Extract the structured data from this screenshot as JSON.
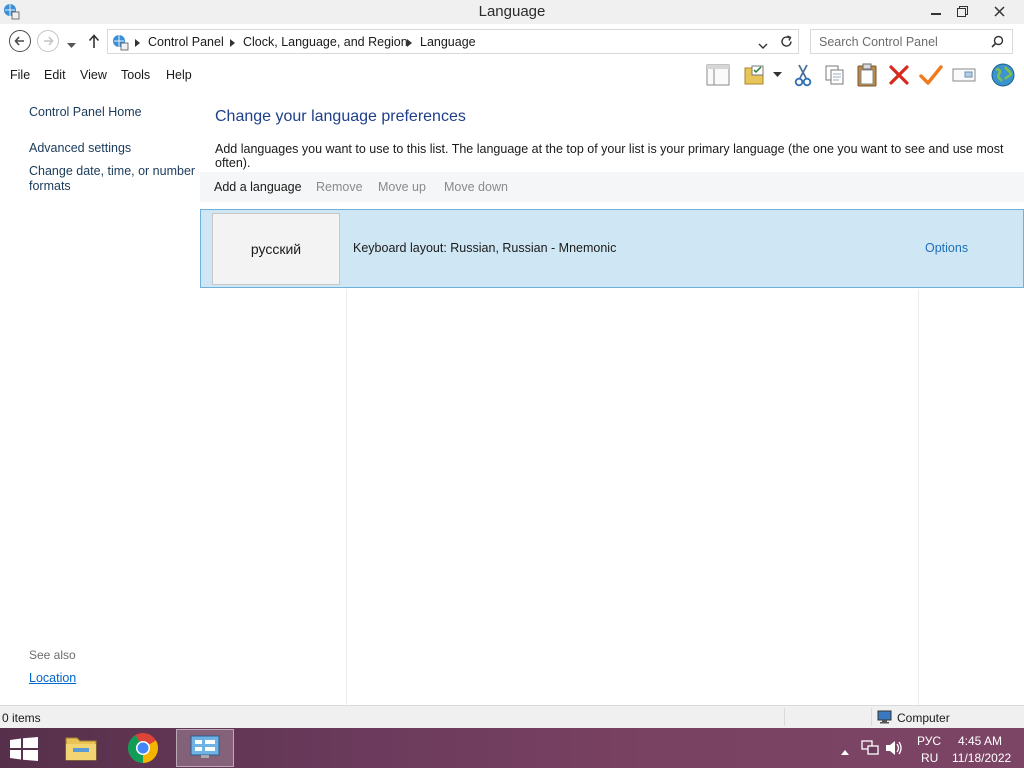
{
  "window": {
    "title": "Language",
    "controls": [
      "minimize",
      "restore",
      "close"
    ]
  },
  "address_bar": {
    "breadcrumbs": [
      "Control Panel",
      "Clock, Language, and Region",
      "Language"
    ],
    "search_placeholder": "Search Control Panel"
  },
  "menu": {
    "items": [
      "File",
      "Edit",
      "View",
      "Tools",
      "Help"
    ]
  },
  "toolbar_icons": [
    "layout-icon",
    "properties-icon",
    "cut-icon",
    "copy-icon",
    "paste-icon",
    "delete-icon",
    "checkmark-icon",
    "rename-icon",
    "globe-icon"
  ],
  "left_nav": {
    "home": "Control Panel Home",
    "links": [
      "Advanced settings",
      "Change date, time, or number formats"
    ],
    "see_also_label": "See also",
    "see_also_links": [
      "Location"
    ]
  },
  "main": {
    "heading": "Change your language preferences",
    "description": "Add languages you want to use to this list. The language at the top of your list is your primary language (the one you want to see and use most often).",
    "commands": [
      {
        "label": "Add a language",
        "enabled": true
      },
      {
        "label": "Remove",
        "enabled": false
      },
      {
        "label": "Move up",
        "enabled": false
      },
      {
        "label": "Move down",
        "enabled": false
      }
    ],
    "languages": [
      {
        "name": "русский",
        "detail": "Keyboard layout: Russian, Russian - Mnemonic",
        "options_label": "Options"
      }
    ]
  },
  "status_bar": {
    "items_text": "0 items",
    "location_text": "Computer"
  },
  "taskbar": {
    "apps": [
      "file-explorer",
      "chrome",
      "control-panel"
    ],
    "tray": {
      "lang_top": "РУС",
      "lang_bottom": "RU",
      "time": "4:45 AM",
      "date": "11/18/2022"
    }
  },
  "colors": {
    "heading": "#1e3f8a",
    "link": "#1f6fb8",
    "selection_bg": "#cfe7f4",
    "selection_border": "#6fb0dd"
  }
}
